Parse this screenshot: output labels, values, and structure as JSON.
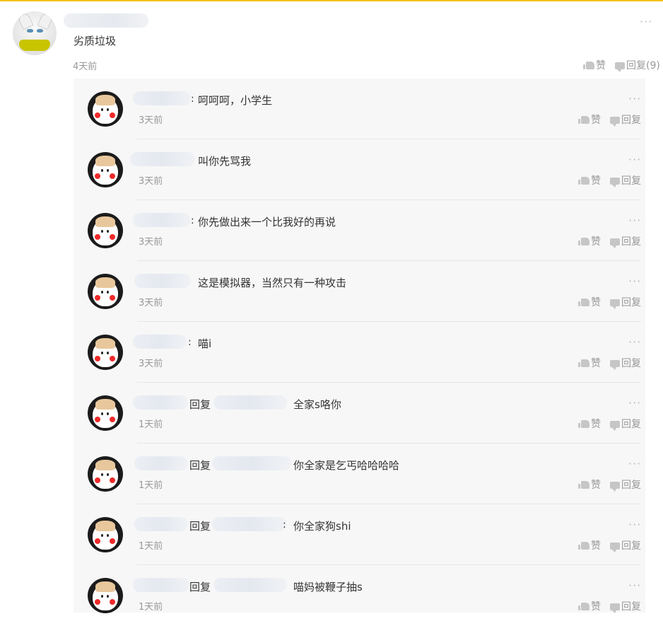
{
  "main_comment": {
    "text": "劣质垃圾",
    "time": "4天前",
    "like_label": "赞",
    "reply_label": "回复(9)",
    "more_label": "···"
  },
  "replies": [
    {
      "text": "呵呵呵，小学生",
      "time": "3天前",
      "type": "direct"
    },
    {
      "text": "叫你先骂我",
      "time": "3天前",
      "type": "direct"
    },
    {
      "text": "你先做出来一个比我好的再说",
      "time": "3天前",
      "type": "direct"
    },
    {
      "text": "这是模拟器，当然只有一种攻击",
      "time": "3天前",
      "type": "direct"
    },
    {
      "text": "喵i",
      "time": "3天前",
      "type": "direct"
    },
    {
      "text": "全家s咯你",
      "time": "1天前",
      "type": "reply_to"
    },
    {
      "text": "你全家是乞丐哈哈哈哈",
      "time": "1天前",
      "type": "reply_to"
    },
    {
      "text": "你全家狗shi",
      "time": "1天前",
      "type": "reply_to"
    },
    {
      "text": "喵妈被鞭子抽s",
      "time": "1天前",
      "type": "reply_to"
    }
  ],
  "labels": {
    "like": "赞",
    "reply": "回复",
    "reply_to_word": "回复",
    "colon": ":",
    "more": "···"
  },
  "colors": {
    "accent_top_border": "#f4c21b",
    "reply_background": "#f7f7f7",
    "muted_text": "#999999"
  }
}
